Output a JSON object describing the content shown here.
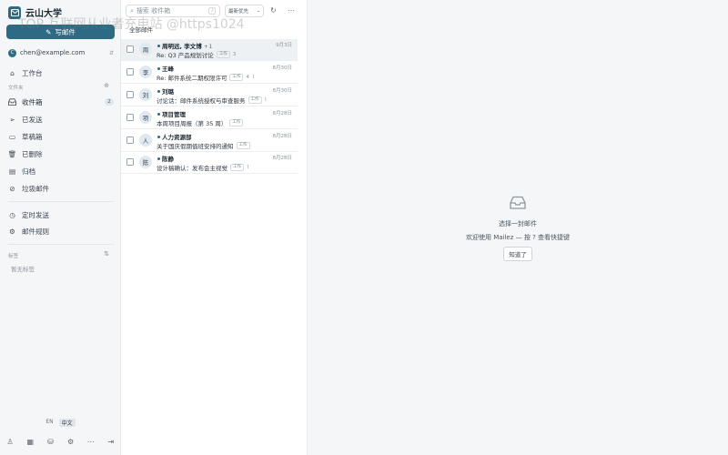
{
  "brand": {
    "name": "云山大学",
    "logo_icon": "mail-logo-icon",
    "accent": "#2d6b84"
  },
  "compose": {
    "label": "写邮件"
  },
  "account": {
    "avatar": "C",
    "email": "chen@example.com"
  },
  "workbench": {
    "label": "工作台"
  },
  "folders": {
    "section_label": "文件夹",
    "items": [
      {
        "label": "收件箱",
        "count": "2",
        "icon": "inbox-icon"
      },
      {
        "label": "已发送",
        "icon": "send-icon"
      },
      {
        "label": "草稿箱",
        "icon": "draft-icon"
      },
      {
        "label": "已删除",
        "icon": "trash-icon"
      },
      {
        "label": "归档",
        "icon": "archive-icon"
      },
      {
        "label": "垃圾邮件",
        "icon": "spam-icon"
      }
    ]
  },
  "extras": {
    "items": [
      {
        "label": "定时发送",
        "icon": "clock-icon"
      },
      {
        "label": "邮件规则",
        "icon": "rules-icon"
      }
    ]
  },
  "tags": {
    "section_label": "标签",
    "empty": "暂无标签"
  },
  "language": {
    "en": "EN",
    "zh": "中文"
  },
  "search": {
    "placeholder": "搜索 收件箱",
    "shortcut": "/"
  },
  "sort": {
    "label": "最新优先"
  },
  "list": {
    "header": "全部邮件",
    "rows": [
      {
        "avatar": "周",
        "sender": "周明远, 李文博",
        "extra": " +1",
        "date": "9月3日",
        "subject": "Re: Q3 产品规划讨论",
        "tag": "工作",
        "meta": "3",
        "selected": true
      },
      {
        "avatar": "李",
        "sender": "王峰",
        "extra": "",
        "date": "8月30日",
        "subject": "Re: 邮件系统二期权限许可",
        "tag": "工作",
        "meta": "4",
        "selected": false
      },
      {
        "avatar": "刘",
        "sender": "刘璐",
        "extra": "",
        "date": "8月30日",
        "subject": "讨论话：邮件系统授权与审查服务",
        "tag": "工作",
        "meta": "",
        "selected": false
      },
      {
        "avatar": "项",
        "sender": "项目管理",
        "extra": "",
        "date": "8月28日",
        "subject": "本周项目周报（第 35 周）",
        "tag": "工作",
        "meta": "",
        "selected": false
      },
      {
        "avatar": "人",
        "sender": "人力资源部",
        "extra": "",
        "date": "8月28日",
        "subject": "关于国庆假期值班安排的通知",
        "tag": "工作",
        "meta": "",
        "selected": false
      },
      {
        "avatar": "陈",
        "sender": "陈静",
        "extra": "",
        "date": "8月28日",
        "subject": "设计稿确认：发布会主视觉",
        "tag": "工作",
        "meta": "",
        "selected": false
      }
    ]
  },
  "reading": {
    "title": "选择一封邮件",
    "hint": "欢迎使用 Mailez — 按 ? 查看快捷键",
    "button": "知道了"
  },
  "watermark": "TOP 互联网从业者充电站 @https1024"
}
